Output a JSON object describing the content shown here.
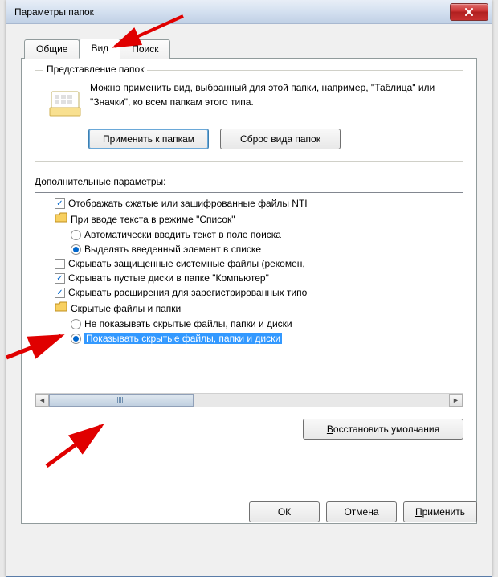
{
  "titlebar": {
    "title": "Параметры папок"
  },
  "tabs": {
    "general": "Общие",
    "view": "Вид",
    "search": "Поиск"
  },
  "groupbox": {
    "title": "Представление папок",
    "text": "Можно применить вид, выбранный для этой папки, например, \"Таблица\" или \"Значки\", ко всем папкам этого типа.",
    "apply_btn": "Применить к папкам",
    "reset_btn": "Сброс вида папок"
  },
  "advanced": {
    "label": "Дополнительные параметры:",
    "items": [
      {
        "type": "checkbox",
        "checked": true,
        "indent": 1,
        "label": "Отображать сжатые или зашифрованные файлы NTI"
      },
      {
        "type": "folder",
        "indent": 1,
        "label": "При вводе текста в режиме \"Список\""
      },
      {
        "type": "radio",
        "checked": false,
        "indent": 2,
        "label": "Автоматически вводить текст в поле поиска"
      },
      {
        "type": "radio",
        "checked": true,
        "indent": 2,
        "label": "Выделять введенный элемент в списке"
      },
      {
        "type": "checkbox",
        "checked": false,
        "indent": 1,
        "label": "Скрывать защищенные системные файлы (рекомен,"
      },
      {
        "type": "checkbox",
        "checked": true,
        "indent": 1,
        "label": "Скрывать пустые диски в папке \"Компьютер\""
      },
      {
        "type": "checkbox",
        "checked": true,
        "indent": 1,
        "label": "Скрывать расширения для зарегистрированных типо"
      },
      {
        "type": "folder",
        "indent": 1,
        "label": "Скрытые файлы и папки"
      },
      {
        "type": "radio",
        "checked": false,
        "indent": 2,
        "label": "Не показывать скрытые файлы, папки и диски"
      },
      {
        "type": "radio",
        "checked": true,
        "indent": 2,
        "selected": true,
        "label": "Показывать скрытые файлы, папки и диски"
      }
    ]
  },
  "buttons": {
    "restore": "Восстановить умолчания",
    "restore_u": "В",
    "ok": "ОК",
    "cancel": "Отмена",
    "apply": "Применить",
    "apply_u": "П"
  }
}
